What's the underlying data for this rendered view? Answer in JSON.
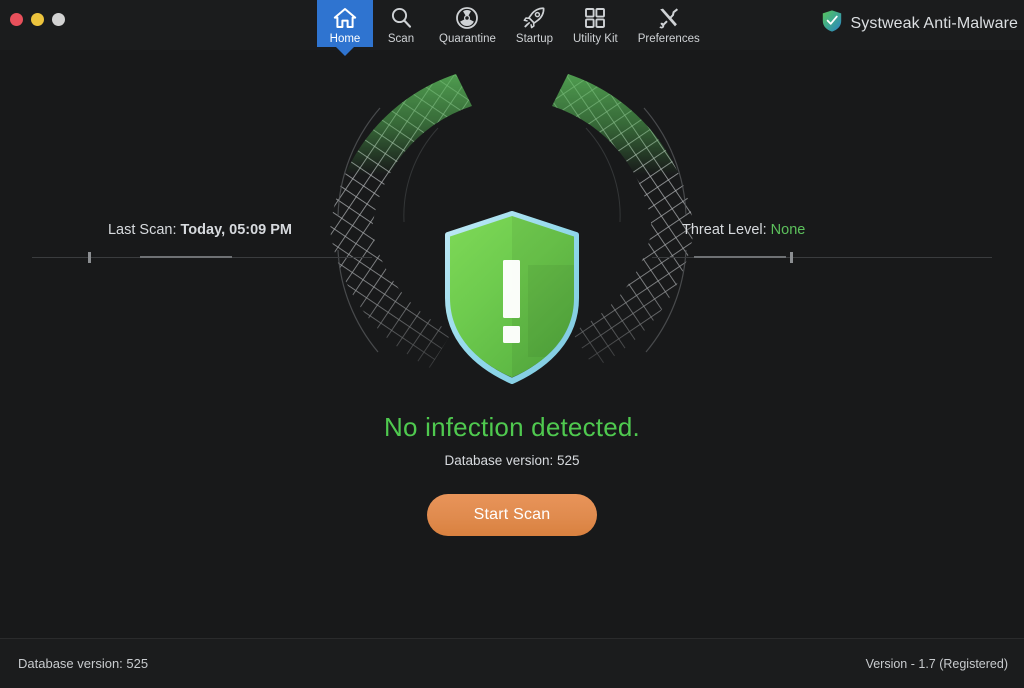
{
  "window": {
    "traffic_lights": [
      {
        "name": "close",
        "color": "#e8505b"
      },
      {
        "name": "minimize",
        "color": "#ecc33d"
      },
      {
        "name": "zoom",
        "color": "#d2d2d2"
      }
    ]
  },
  "toolbar": {
    "active_tab": "Home",
    "accent_color": "#2f74d0",
    "items": [
      {
        "label": "Home",
        "icon": "home-icon",
        "active": true
      },
      {
        "label": "Scan",
        "icon": "search-icon",
        "active": false
      },
      {
        "label": "Quarantine",
        "icon": "radiation-icon",
        "active": false
      },
      {
        "label": "Startup",
        "icon": "rocket-icon",
        "active": false
      },
      {
        "label": "Utility Kit",
        "icon": "grid-icon",
        "active": false
      },
      {
        "label": "Preferences",
        "icon": "tools-icon",
        "active": false
      }
    ]
  },
  "brand": {
    "name": "Systweak Anti-Malware",
    "logo_icon": "shield-logo-icon"
  },
  "main": {
    "last_scan_label": "Last Scan:",
    "last_scan_value": "Today, 05:09 PM",
    "threat_level_label": "Threat Level:",
    "threat_level_value": "None",
    "threat_level_color": "#5cc05c",
    "status_icon": "shield-exclamation-icon",
    "headline": "No infection detected.",
    "headline_color": "#4fc94f",
    "database_version": "Database version: 525",
    "start_scan_label": "Start Scan",
    "start_scan_color": "#e08b4e"
  },
  "footer": {
    "database_version": "Database version: 525",
    "version": "Version  -  1.7 (Registered)"
  }
}
